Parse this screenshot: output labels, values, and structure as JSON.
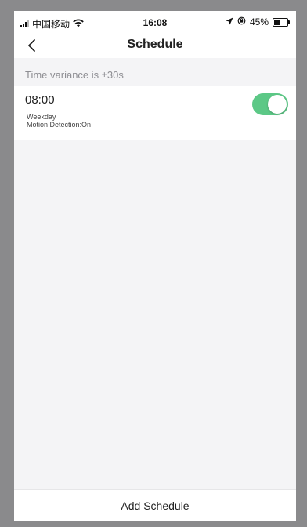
{
  "status_bar": {
    "carrier": "中国移动",
    "time": "16:08",
    "battery_percent": "45%",
    "battery_level": 0.45
  },
  "nav": {
    "title": "Schedule"
  },
  "info": {
    "time_variance": "Time variance is  ±30s"
  },
  "schedules": [
    {
      "time": "08:00",
      "repeat": "Weekday",
      "action": "Motion Detection:On",
      "enabled": true
    }
  ],
  "footer": {
    "add_label": "Add Schedule"
  },
  "colors": {
    "toggle_on": "#5cc886",
    "background": "#f4f4f6",
    "frame": "#8a8a8c"
  },
  "icons": {
    "back": "chevron-left-icon",
    "wifi": "wifi-icon",
    "location": "location-arrow-icon",
    "lock_rotation": "orientation-lock-icon",
    "battery": "battery-icon",
    "signal": "cellular-signal-icon"
  }
}
